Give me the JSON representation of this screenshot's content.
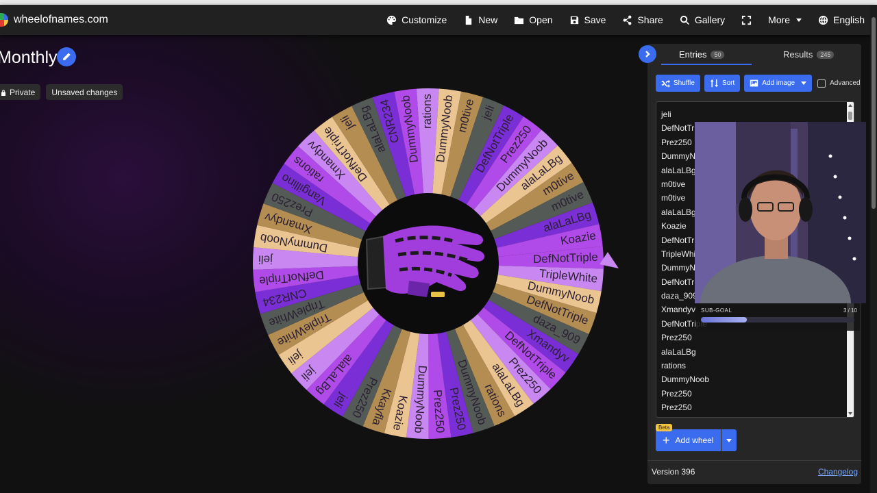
{
  "navbar": {
    "brand": "wheelofnames.com",
    "items": [
      {
        "label": "Customize",
        "icon": "palette-icon"
      },
      {
        "label": "New",
        "icon": "file-icon"
      },
      {
        "label": "Open",
        "icon": "folder-icon"
      },
      {
        "label": "Save",
        "icon": "save-icon"
      },
      {
        "label": "Share",
        "icon": "share-icon"
      },
      {
        "label": "Gallery",
        "icon": "search-icon"
      },
      {
        "label": "",
        "icon": "fullscreen-icon"
      },
      {
        "label": "More",
        "icon": "caret-down-icon"
      },
      {
        "label": "English",
        "icon": "globe-icon"
      }
    ]
  },
  "wheel": {
    "title": "Monthly",
    "visibility": "Private",
    "status": "Unsaved changes",
    "colors": [
      "#b04ae8",
      "#c987f2",
      "#eac592",
      "#b48d52",
      "#545a55",
      "#7a2fd6"
    ],
    "segments": [
      "DefNotTriple",
      "TripleWhite",
      "DummyNoob",
      "DefNotTriple",
      "daza_909",
      "Xmandyv",
      "DefNotTriple",
      "Prez250",
      "alaLaLBg",
      "rations",
      "DummyNoob",
      "Prez250",
      "Prez250",
      "DummyNoob",
      "Koazie",
      "Kkayfla",
      "Prez250",
      "jeli",
      "alaLaLBg",
      "jeli",
      "jeli",
      "TripleWhite",
      "TripleWhite",
      "CNR234",
      "DefNotTriple",
      "jeli",
      "DummyNoob",
      "Xmandyv",
      "Prez250",
      "Vangillino",
      "rations",
      "Xmandyv",
      "DefNotTriple",
      "jeli",
      "alaLaLBg",
      "CNR234",
      "DummyNoob",
      "rations",
      "DummyNoob",
      "m0tive",
      "jeli",
      "DefNotTriple",
      "Prez250",
      "DummyNoob",
      "alaLaLBg",
      "m0tive",
      "m0tive",
      "alaLaLBg",
      "Koazie"
    ]
  },
  "panel": {
    "tabs": [
      {
        "label": "Entries",
        "count": "50"
      },
      {
        "label": "Results",
        "count": "245"
      }
    ],
    "toolbar": {
      "shuffle": "Shuffle",
      "sort": "Sort",
      "add_image": "Add image",
      "advanced": "Advanced"
    },
    "entries": [
      "jeli",
      "DefNotTriple",
      "Prez250",
      "DummyNoob",
      "alaLaLBg",
      "m0tive",
      "m0tive",
      "alaLaLBg",
      "Koazie",
      "DefNotTriple",
      "TripleWhite",
      "DummyNoob",
      "DefNotTriple",
      "daza_909",
      "Xmandyv",
      "DefNotTriple",
      "Prez250",
      "alaLaLBg",
      "rations",
      "DummyNoob",
      "Prez250",
      "Prez250"
    ],
    "add_wheel": "Add wheel",
    "beta": "Beta",
    "version": "Version 396",
    "changelog": "Changelog"
  },
  "overlay": {
    "subgoal_label": "SUB-GOAL",
    "subgoal_count": "3 / 10",
    "subgoal_progress": 0.3
  }
}
